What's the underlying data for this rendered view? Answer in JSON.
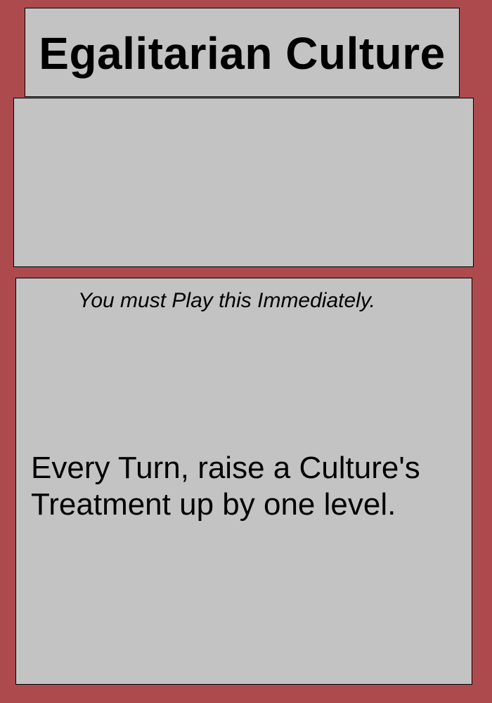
{
  "card": {
    "title": "Egalitarian Culture",
    "play_instruction": "You must Play this Immediately.",
    "effect_text": "Every Turn, raise a Culture's Treatment up by one level."
  },
  "colors": {
    "background": "#ad4a4d",
    "panel": "#c3c3c3",
    "border": "#000000",
    "text": "#000000"
  }
}
